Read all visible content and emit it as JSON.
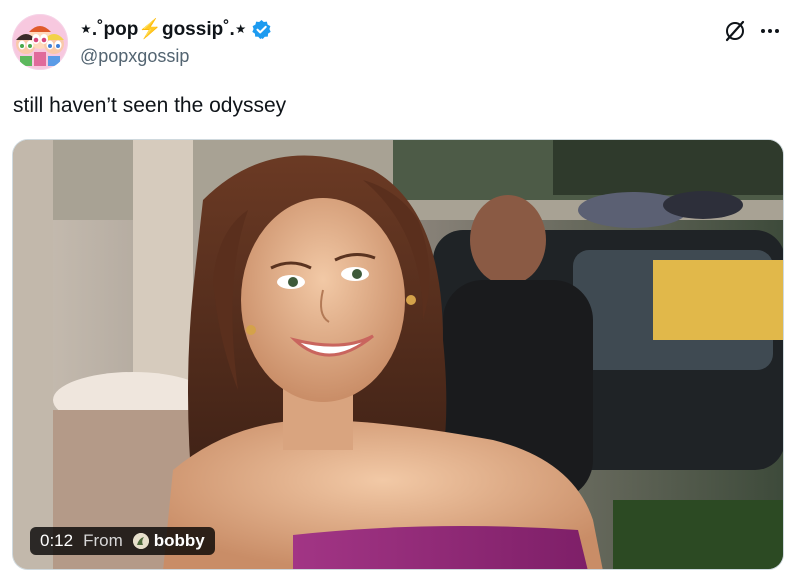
{
  "author": {
    "display_name": "⋆.˚pop⚡gossip˚.⋆",
    "handle": "@popxgossip",
    "verified": true,
    "avatar_icon": "powerpuff-girls-avatar",
    "verified_icon": "verified-badge-icon",
    "verified_color": "#1d9bf0"
  },
  "actions": {
    "grok_icon": "grok-icon",
    "more_icon": "more-options-icon"
  },
  "tweet": {
    "text": "still haven’t seen the odyssey"
  },
  "media": {
    "type": "video",
    "duration": "0:12",
    "from_label": "From",
    "source_name": "bobby",
    "source_avatar_icon": "bobby-avatar"
  },
  "colors": {
    "text_primary": "#0f1419",
    "text_secondary": "#536471",
    "border": "#cfd9de",
    "dress": "#9b2f7e"
  }
}
